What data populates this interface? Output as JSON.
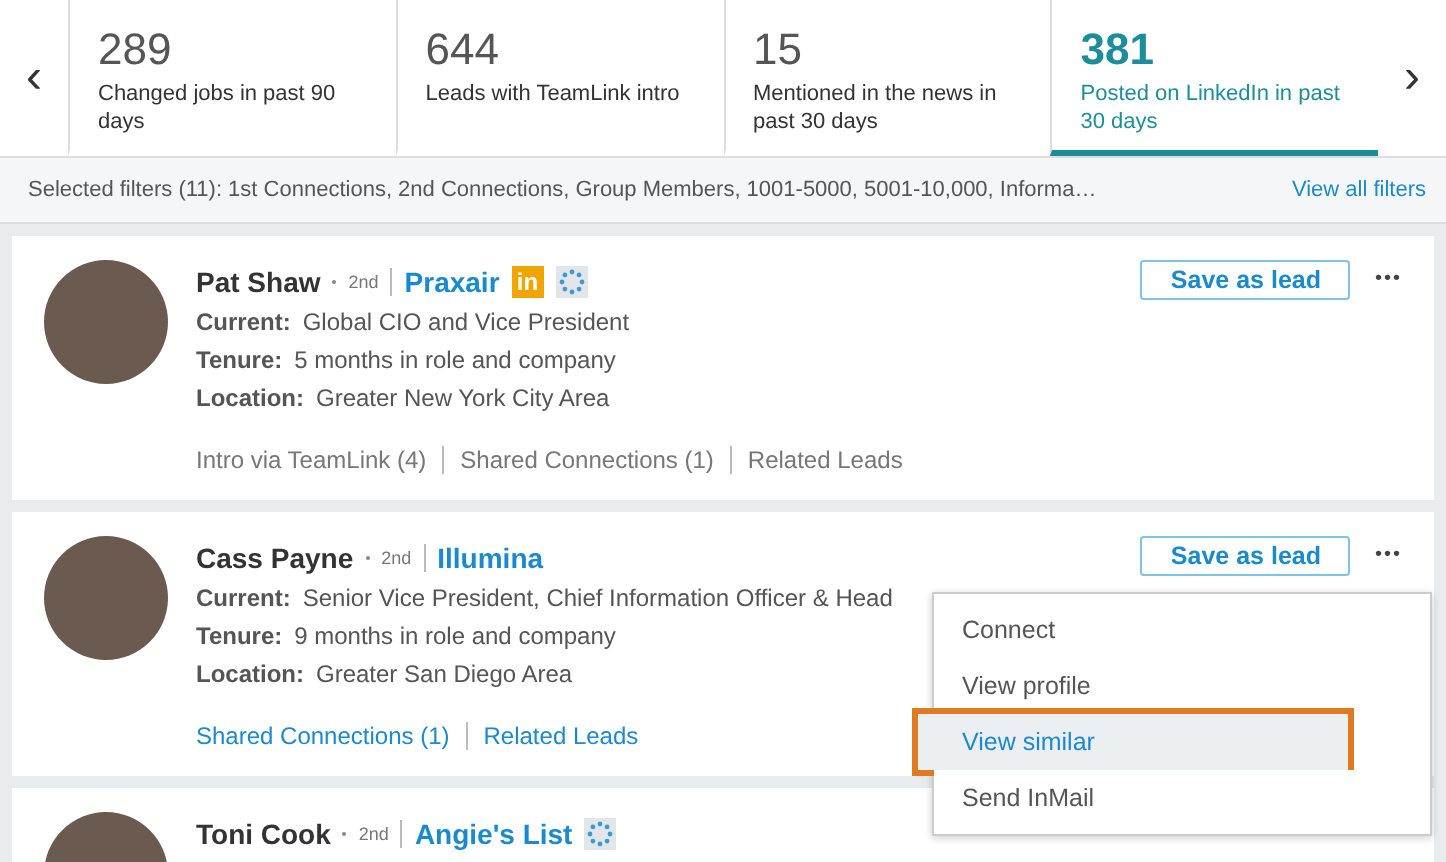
{
  "stats_bar": {
    "prev": "‹",
    "next": "›",
    "tabs": [
      {
        "count": "289",
        "label": "Changed jobs in past 90 days",
        "selected": false
      },
      {
        "count": "644",
        "label": "Leads with TeamLink intro",
        "selected": false
      },
      {
        "count": "15",
        "label": "Mentioned in the news in past 30 days",
        "selected": false
      },
      {
        "count": "381",
        "label": "Posted on LinkedIn in past 30 days",
        "selected": true
      }
    ]
  },
  "filters": {
    "text": "Selected filters (11):  1st Connections, 2nd Connections, Group Members, 1001-5000, 5001-10,000, Informa…",
    "link": "View all filters"
  },
  "leads": [
    {
      "name": "Pat Shaw",
      "degree": "2nd",
      "company": "Praxair",
      "badges": [
        {
          "kind": "linkedin",
          "text": "in"
        },
        {
          "kind": "spinner"
        }
      ],
      "save": "Save as lead",
      "more": "•••",
      "fields": [
        {
          "label": "Current:",
          "value": "Global CIO and Vice President"
        },
        {
          "label": "Tenure:",
          "value": "5 months in role and company"
        },
        {
          "label": "Location:",
          "value": "Greater New York City Area"
        }
      ],
      "links": [
        {
          "label": "Intro via TeamLink (4)",
          "disabled": true
        },
        {
          "label": "Shared Connections (1)",
          "disabled": true
        },
        {
          "label": "Related Leads",
          "disabled": true
        }
      ]
    },
    {
      "name": "Cass Payne",
      "degree": "2nd",
      "company": "Illumina",
      "save": "Save as lead",
      "more": "•••",
      "fields": [
        {
          "label": "Current:",
          "value": "Senior Vice President, Chief Information Officer & Head"
        },
        {
          "label": "Tenure:",
          "value": "9 months in role and company"
        },
        {
          "label": "Location:",
          "value": "Greater San Diego Area"
        }
      ],
      "links": [
        {
          "label": "Shared Connections (1)",
          "disabled": false
        },
        {
          "label": "Related Leads",
          "disabled": false
        }
      ],
      "menu": [
        {
          "label": "Connect",
          "selected": false
        },
        {
          "label": "View profile",
          "selected": false
        },
        {
          "label": "View similar",
          "selected": true
        },
        {
          "label": "Send InMail",
          "selected": false
        }
      ]
    },
    {
      "name": "Toni Cook",
      "degree": "2nd",
      "company": "Angie's List",
      "badges": [
        {
          "kind": "spinner"
        }
      ]
    }
  ]
}
